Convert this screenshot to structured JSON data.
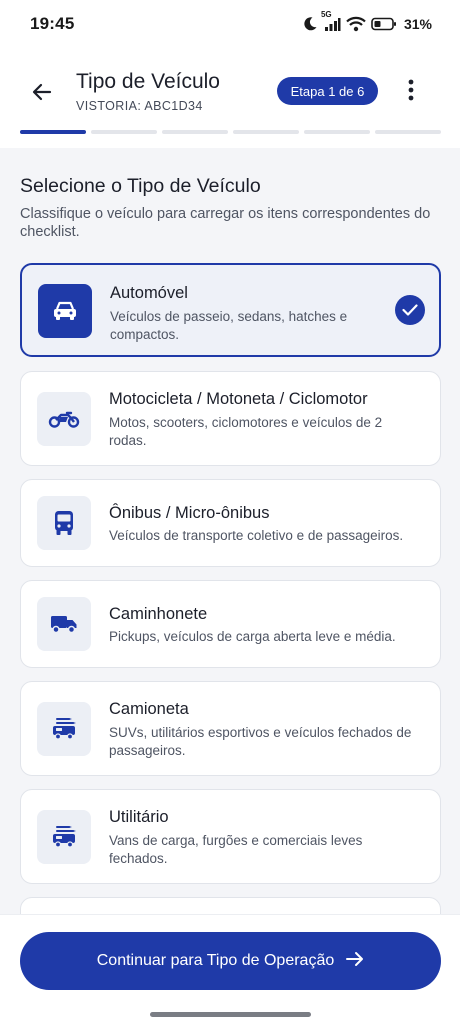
{
  "status_bar": {
    "time": "19:45",
    "network": "5G",
    "battery": "31%",
    "icons": [
      "moon-icon",
      "signal-icon",
      "wifi-icon",
      "battery-icon"
    ]
  },
  "app_bar": {
    "title": "Tipo de Veículo",
    "subtitle": "VISTORIA: ABC1D34",
    "step_label": "Etapa 1 de 6",
    "steps_total": 6,
    "steps_current": 1,
    "icons": [
      "arrow-left-icon",
      "more-vert-icon"
    ]
  },
  "section": {
    "title": "Selecione o Tipo de Veículo",
    "description": "Classifique o veículo para carregar os itens correspondentes do checklist."
  },
  "vehicle_types": [
    {
      "title": "Automóvel",
      "description": "Veículos de passeio, sedans, hatches e compactos.",
      "icon": "car-icon",
      "selected": true
    },
    {
      "title": "Motocicleta / Motoneta / Ciclomotor",
      "description": "Motos, scooters, ciclomotores e veículos de 2 rodas.",
      "icon": "motorcycle-icon",
      "selected": false
    },
    {
      "title": "Ônibus / Micro-ônibus",
      "description": "Veículos de transporte coletivo e de passageiros.",
      "icon": "bus-icon",
      "selected": false
    },
    {
      "title": "Caminhonete",
      "description": "Pickups, veículos de carga aberta leve e média.",
      "icon": "truck-icon",
      "selected": false
    },
    {
      "title": "Camioneta",
      "description": "SUVs, utilitários esportivos e veículos fechados de passageiros.",
      "icon": "rv-icon",
      "selected": false
    },
    {
      "title": "Utilitário",
      "description": "Vans de carga, furgões e comerciais leves fechados.",
      "icon": "rv-icon",
      "selected": false
    }
  ],
  "footer": {
    "continue_label": "Continuar para Tipo de Operação",
    "icons": [
      "arrow-right-icon"
    ]
  },
  "colors": {
    "primary": "#1f3aa8",
    "selected_bg": "#eef1f8",
    "card_border": "#e1e4ea",
    "icon_bg": "#eceff5"
  }
}
